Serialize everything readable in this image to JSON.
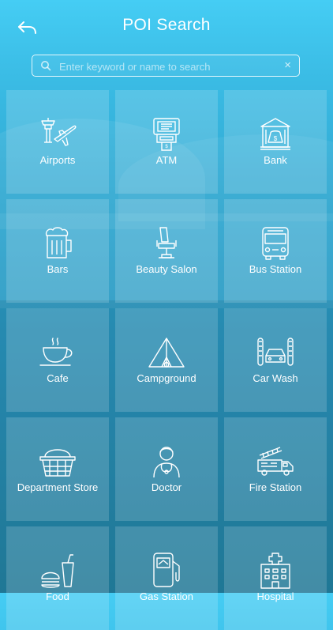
{
  "header": {
    "title": "POI Search"
  },
  "search": {
    "placeholder": "Enter keyword or name to search",
    "clear_symbol": "×"
  },
  "categories": [
    {
      "label": "Airports",
      "icon": "airport-icon"
    },
    {
      "label": "ATM",
      "icon": "atm-icon"
    },
    {
      "label": "Bank",
      "icon": "bank-icon"
    },
    {
      "label": "Bars",
      "icon": "beer-mug-icon"
    },
    {
      "label": "Beauty Salon",
      "icon": "salon-chair-icon"
    },
    {
      "label": "Bus Station",
      "icon": "bus-icon"
    },
    {
      "label": "Cafe",
      "icon": "coffee-cup-icon"
    },
    {
      "label": "Campground",
      "icon": "tent-icon"
    },
    {
      "label": "Car Wash",
      "icon": "car-wash-icon"
    },
    {
      "label": "Department Store",
      "icon": "shopping-basket-icon"
    },
    {
      "label": "Doctor",
      "icon": "doctor-icon"
    },
    {
      "label": "Fire Station",
      "icon": "fire-truck-icon"
    },
    {
      "label": "Food",
      "icon": "fast-food-icon"
    },
    {
      "label": "Gas Station",
      "icon": "fuel-pump-icon"
    },
    {
      "label": "Hospital",
      "icon": "hospital-building-icon"
    }
  ]
}
